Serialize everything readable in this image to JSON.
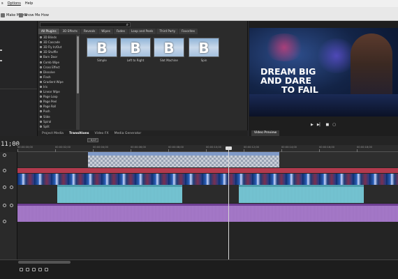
{
  "menu": {
    "items": [
      "s",
      "Options",
      "Help"
    ]
  },
  "toolbar": {
    "ripple_label": "Make Movie",
    "showme_label": "Show Me How"
  },
  "transitions": {
    "search_placeholder": "",
    "category_tabs": [
      "All Plugins",
      "3D Effects",
      "Reveals",
      "Wipes",
      "Fades",
      "Loop and Peels",
      "Third Party",
      "Favorites"
    ],
    "active_tab_index": 0,
    "list": [
      "3D Blinds",
      "3D Cascade",
      "3D Fly In/Out",
      "3D Shuffle",
      "Barn Door",
      "Comb Wipe",
      "Cross Effect",
      "Dissolve",
      "Flash",
      "Gradient Wipe",
      "Iris",
      "Linear Wipe",
      "Page Loop",
      "Page Peel",
      "Page Roll",
      "Push",
      "Slide",
      "Spiral",
      "Split"
    ],
    "thumbnails": [
      {
        "label": "Simple",
        "glyph": "B"
      },
      {
        "label": "Left to Right",
        "glyph": "B"
      },
      {
        "label": "Slot Machine",
        "glyph": "B"
      },
      {
        "label": "Spin",
        "glyph": "B"
      }
    ],
    "panel_tabs": [
      "Project Media",
      "Transitions",
      "Video FX",
      "Media Generator"
    ],
    "active_panel_tab_index": 1
  },
  "preview": {
    "line1": "DREAM BIG",
    "line2": "AND DARE",
    "line3": "TO FAIL",
    "tab_label": "Video Preview",
    "controls": [
      "play-icon",
      "step-forward-icon",
      "stop-icon",
      "loop-icon"
    ]
  },
  "timeline": {
    "timecode": "11;00",
    "ruler_ticks": [
      "00:00:00;00",
      "00:00:02;00",
      "00:00:04;00",
      "00:00:06;00",
      "00:00:08;00",
      "00:00:10;00",
      "00:00:12;00",
      "00:00:14;00",
      "00:00:16;00",
      "00:00:18;00"
    ],
    "marker_label": "0;17"
  },
  "colors": {
    "overlay_track": "#7f9ac8",
    "title_track": "#b23a4d",
    "video_track": "#1c3c78",
    "audio_clip": "#5fb7c7",
    "music_track": "#8b58b3"
  }
}
